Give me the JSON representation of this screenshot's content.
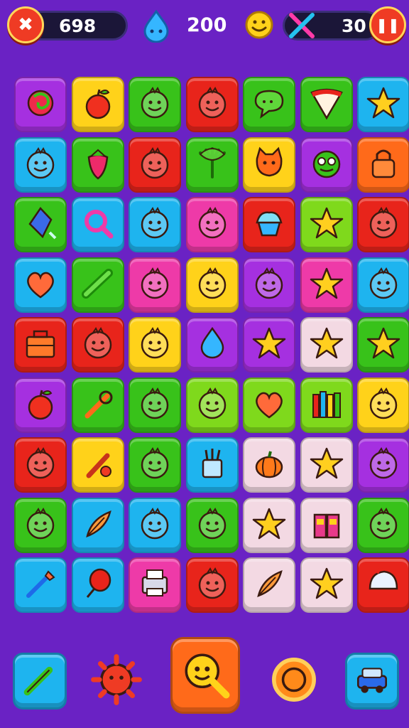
{
  "hud": {
    "score": "698",
    "drops": "200",
    "moves": "30",
    "back_label": "✖",
    "pause_label": "❚❚"
  },
  "colors": {
    "purple": "#a530e0",
    "yellow": "#ffd21a",
    "green": "#38c21a",
    "red": "#e8241b",
    "lime": "#7fd91c",
    "blue": "#1eb4ef",
    "orange": "#ff6a1a",
    "pink": "#ee3aa8",
    "white": "#f3d9e3",
    "background": "#6a22c4"
  },
  "board": {
    "rows": [
      [
        {
          "c": "purple",
          "icon": "swirl-icon"
        },
        {
          "c": "yellow",
          "icon": "apple-icon"
        },
        {
          "c": "green",
          "icon": "smiley-icon"
        },
        {
          "c": "red",
          "icon": "smiley-icon"
        },
        {
          "c": "green",
          "icon": "chat-bubble-icon"
        },
        {
          "c": "green",
          "icon": "pizza-slice-icon"
        },
        {
          "c": "blue",
          "icon": "star-icon"
        }
      ],
      [
        {
          "c": "blue",
          "icon": "smiley-icon"
        },
        {
          "c": "green",
          "icon": "strawberry-icon"
        },
        {
          "c": "red",
          "icon": "smiley-icon"
        },
        {
          "c": "green",
          "icon": "leaf-icon"
        },
        {
          "c": "yellow",
          "icon": "cat-face-icon"
        },
        {
          "c": "purple",
          "icon": "frog-face-icon"
        },
        {
          "c": "orange",
          "icon": "lock-icon"
        }
      ],
      [
        {
          "c": "green",
          "icon": "crystal-icon"
        },
        {
          "c": "blue",
          "icon": "magnifier-icon"
        },
        {
          "c": "blue",
          "icon": "smiley-icon"
        },
        {
          "c": "pink",
          "icon": "smiley-icon"
        },
        {
          "c": "red",
          "icon": "cupcake-icon"
        },
        {
          "c": "lime",
          "icon": "star-icon"
        },
        {
          "c": "red",
          "icon": "smiley-icon"
        }
      ],
      [
        {
          "c": "blue",
          "icon": "heart-icon"
        },
        {
          "c": "green",
          "icon": "cactus-icon"
        },
        {
          "c": "pink",
          "icon": "smiley-icon"
        },
        {
          "c": "yellow",
          "icon": "smiley-icon"
        },
        {
          "c": "purple",
          "icon": "smiley-icon"
        },
        {
          "c": "pink",
          "icon": "star-icon"
        },
        {
          "c": "blue",
          "icon": "smiley-icon"
        }
      ],
      [
        {
          "c": "red",
          "icon": "toolbox-icon"
        },
        {
          "c": "red",
          "icon": "smiley-icon"
        },
        {
          "c": "yellow",
          "icon": "smiley-icon"
        },
        {
          "c": "purple",
          "icon": "drop-icon"
        },
        {
          "c": "purple",
          "icon": "star-icon"
        },
        {
          "c": "white",
          "icon": "star-icon"
        },
        {
          "c": "green",
          "icon": "star-icon"
        }
      ],
      [
        {
          "c": "purple",
          "icon": "apple-icon"
        },
        {
          "c": "green",
          "icon": "wrench-icon"
        },
        {
          "c": "green",
          "icon": "smiley-icon"
        },
        {
          "c": "lime",
          "icon": "smiley-icon"
        },
        {
          "c": "lime",
          "icon": "heart-icon"
        },
        {
          "c": "lime",
          "icon": "books-icon"
        },
        {
          "c": "yellow",
          "icon": "smiley-icon"
        }
      ],
      [
        {
          "c": "red",
          "icon": "smiley-icon"
        },
        {
          "c": "yellow",
          "icon": "hammer-icon"
        },
        {
          "c": "green",
          "icon": "smiley-icon"
        },
        {
          "c": "blue",
          "icon": "pencil-cup-icon"
        },
        {
          "c": "white",
          "icon": "pumpkin-icon"
        },
        {
          "c": "white",
          "icon": "star-icon"
        },
        {
          "c": "purple",
          "icon": "smiley-icon"
        }
      ],
      [
        {
          "c": "green",
          "icon": "smiley-icon"
        },
        {
          "c": "blue",
          "icon": "feather-icon"
        },
        {
          "c": "blue",
          "icon": "smiley-icon"
        },
        {
          "c": "green",
          "icon": "smiley-icon"
        },
        {
          "c": "white",
          "icon": "star-icon"
        },
        {
          "c": "white",
          "icon": "gift-box-icon"
        },
        {
          "c": "green",
          "icon": "smiley-icon"
        }
      ],
      [
        {
          "c": "blue",
          "icon": "paintbrush-icon"
        },
        {
          "c": "blue",
          "icon": "balloon-icon"
        },
        {
          "c": "pink",
          "icon": "printer-icon"
        },
        {
          "c": "red",
          "icon": "smiley-icon"
        },
        {
          "c": "white",
          "icon": "feather-icon"
        },
        {
          "c": "white",
          "icon": "star-icon"
        },
        {
          "c": "red",
          "icon": "helmet-icon"
        }
      ]
    ]
  },
  "powerups": [
    {
      "name": "pencil-powerup-button",
      "icon": "pencil-icon",
      "color": "#1eb4ef"
    },
    {
      "name": "sun-powerup-button",
      "icon": "sun-icon",
      "color": "#ef3b24"
    },
    {
      "name": "hint-powerup-button",
      "icon": "magnifier-smiley-icon",
      "color": "#ff6a1a"
    },
    {
      "name": "coin-powerup-button",
      "icon": "coin-icon",
      "color": "#ff8a1a"
    },
    {
      "name": "car-powerup-button",
      "icon": "car-icon",
      "color": "#1eb4ef"
    }
  ]
}
